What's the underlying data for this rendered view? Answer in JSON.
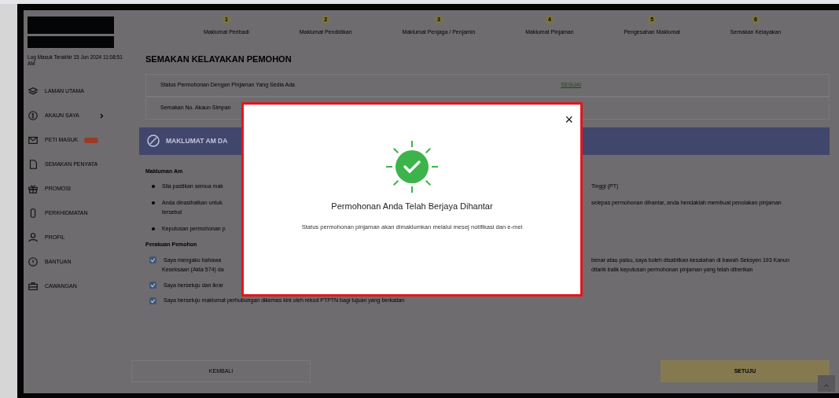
{
  "sidebar": {
    "last_login": "Log Masuk Terakhir 15 Jun 2024 11:08:51 AM",
    "items": [
      {
        "label": "LAMAN UTAMA",
        "expandable": false,
        "has_badge": false
      },
      {
        "label": "AKAUN SAYA",
        "expandable": true,
        "has_badge": false
      },
      {
        "label": "PETI MASUK",
        "expandable": false,
        "has_badge": true
      },
      {
        "label": "SEMAKAN PENYATA",
        "expandable": false,
        "has_badge": false
      },
      {
        "label": "PROMOSI",
        "expandable": false,
        "has_badge": false
      },
      {
        "label": "PERKHIDMATAN",
        "expandable": false,
        "has_badge": false
      },
      {
        "label": "PROFIL",
        "expandable": false,
        "has_badge": false
      },
      {
        "label": "BANTUAN",
        "expandable": false,
        "has_badge": false
      },
      {
        "label": "CAWANGAN",
        "expandable": false,
        "has_badge": false
      }
    ]
  },
  "stepper": [
    {
      "number": "1",
      "label": "Maklumat Peribadi"
    },
    {
      "number": "2",
      "label": "Maklumat Pendidikan"
    },
    {
      "number": "3",
      "label": "Maklumat Penjaga / Penjamin"
    },
    {
      "number": "4",
      "label": "Maklumat Pinjaman"
    },
    {
      "number": "5",
      "label": "Pengesahan Maklumat"
    },
    {
      "number": "6",
      "label": "Semakan Kelayakan"
    }
  ],
  "main": {
    "title": "SEMAKAN KELAYAKAN PEMOHON",
    "status_rows": [
      {
        "label": "Status Permohonan Dengan Pinjaman Yang Sedia Ada",
        "value": "SESUAI"
      },
      {
        "label": "Semakan No. Akaun Simpan"
      }
    ],
    "banner_title": "MAKLUMAT AM DA",
    "general_heading": "Makluman Am",
    "general_items": [
      {
        "left": "Sila pastikan semua mak",
        "right": "Tinggi (PT)"
      },
      {
        "left": "Anda dinasihatkan untuk",
        "right": "selepas permohonan dihantar, anda hendaklah membuat penolakan pinjaman",
        "extra": "tersebut"
      },
      {
        "left": "Keputusan permohonan p"
      }
    ],
    "declaration_heading": "Perakuan Pemohon",
    "declarations": [
      {
        "left": "Saya mengaku bahawa",
        "right": "benar atau palsu, saya boleh disabitkan kesalahan di bawah Seksyen 193 Kanun",
        "left2": "Keseksaan (Akta 574) da",
        "right2": "ditarik balik keputusan permohonan pinjaman yang telah diberikan",
        "checked": true
      },
      {
        "left": "Saya bersetuju dan ikrar",
        "checked": true
      },
      {
        "left": "Saya bersetuju maklumat perhubungan dikemas kini oleh rekod PTPTN bagi tujuan yang berkaitan",
        "checked": true
      }
    ],
    "back_button": "KEMBALI",
    "agree_button": "SETUJU"
  },
  "modal": {
    "title": "Permohonan Anda Telah Berjaya Dihantar",
    "message": "Status permohonan pinjaman akan dimaklumkan melalui mesej notifikasi dan e-mel",
    "close": "×"
  }
}
